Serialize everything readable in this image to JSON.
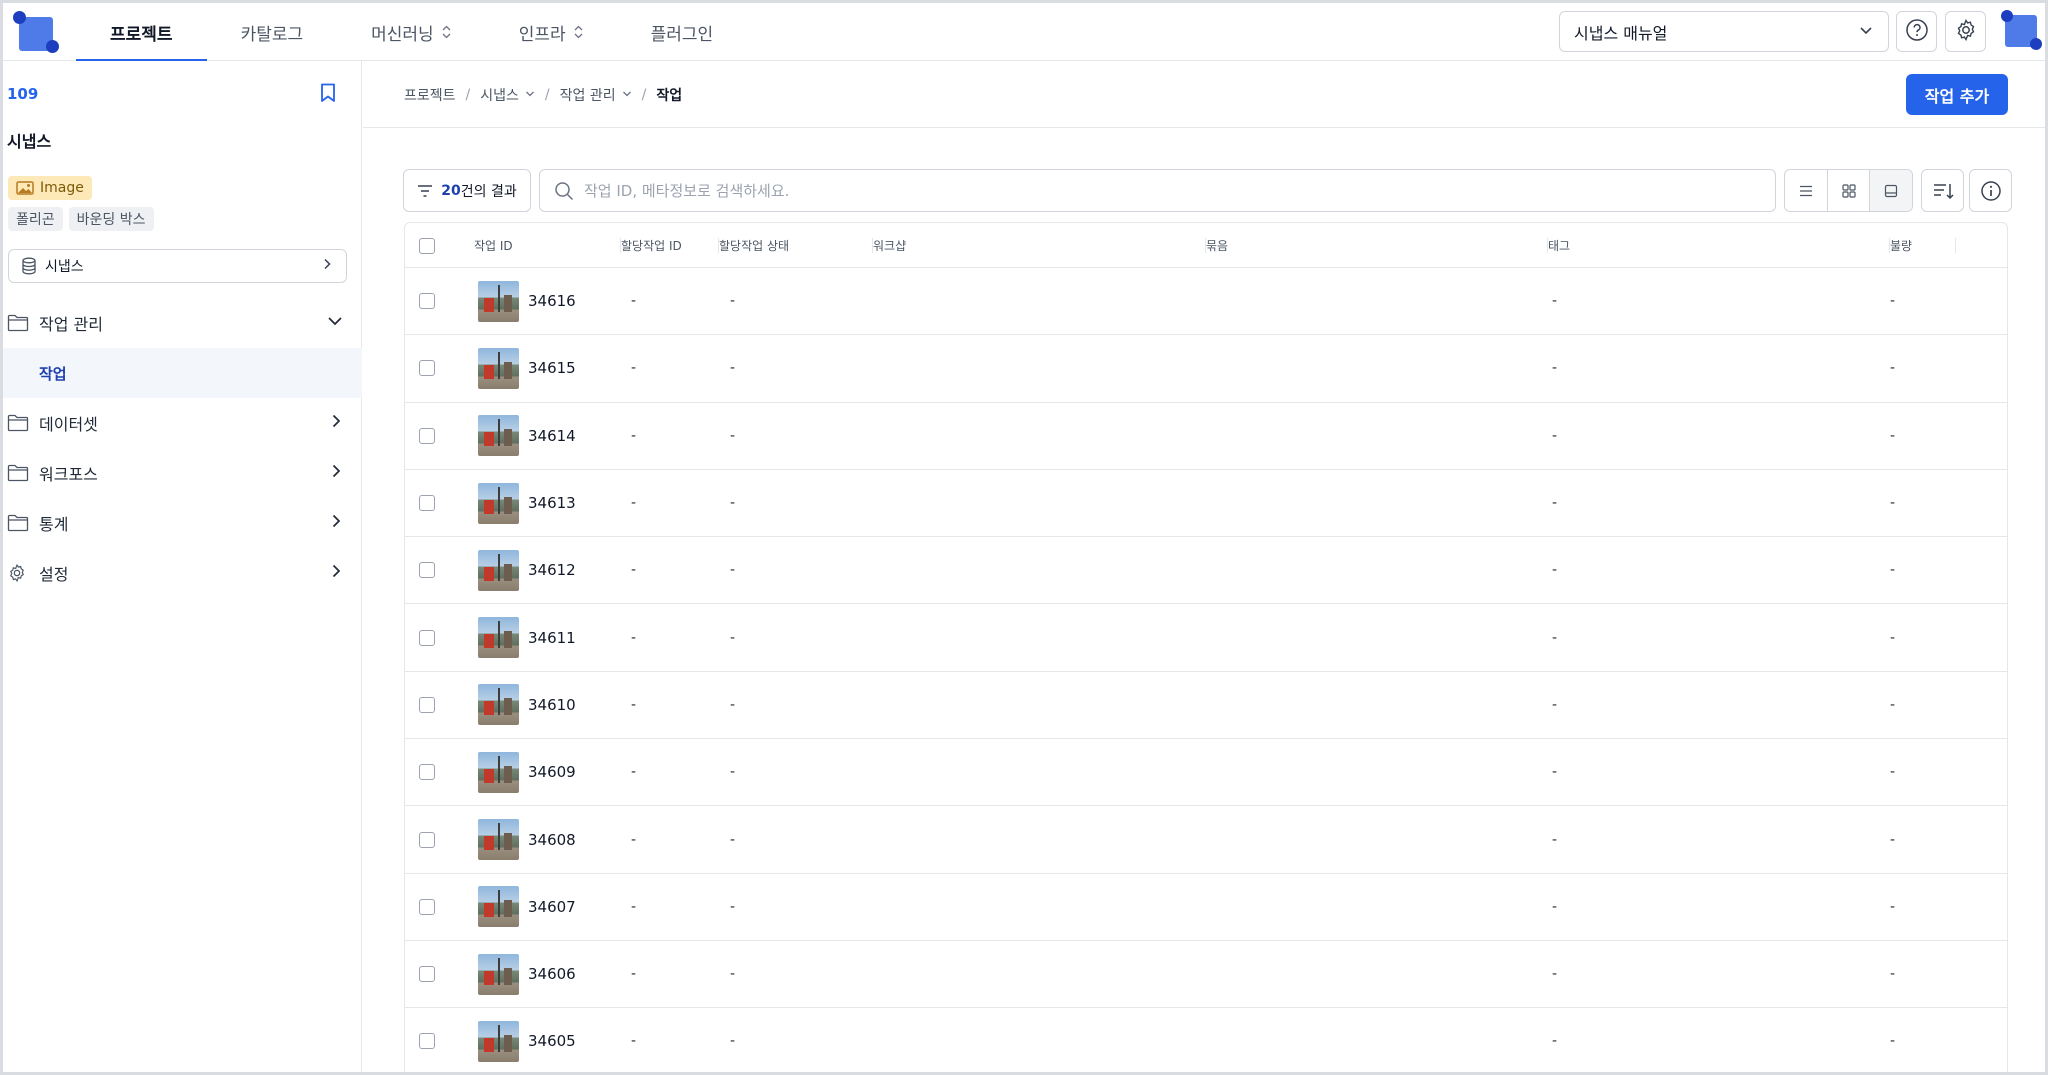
{
  "nav": {
    "tabs": [
      {
        "label": "프로젝트",
        "active": true,
        "has_updown": false
      },
      {
        "label": "카탈로그",
        "active": false,
        "has_updown": false
      },
      {
        "label": "머신러닝",
        "active": false,
        "has_updown": true
      },
      {
        "label": "인프라",
        "active": false,
        "has_updown": true
      },
      {
        "label": "플러그인",
        "active": false,
        "has_updown": false
      }
    ],
    "manual_select": "시냅스 매뉴얼",
    "icons": [
      "help-icon",
      "gear-icon"
    ],
    "accent_color": "#2563eb"
  },
  "sidebar": {
    "project_id": "109",
    "project_name": "시냅스",
    "data_type": "Image",
    "annotation_types": [
      "폴리곤",
      "바운딩 박스"
    ],
    "dataset": "시냅스",
    "menu": [
      {
        "label": "작업 관리",
        "icon": "folder-icon",
        "expanded": true
      },
      {
        "label": "데이터셋",
        "icon": "folder-icon",
        "expanded": false
      },
      {
        "label": "워크포스",
        "icon": "folder-icon",
        "expanded": false
      },
      {
        "label": "통계",
        "icon": "folder-icon",
        "expanded": false
      },
      {
        "label": "설정",
        "icon": "gear-icon",
        "expanded": false
      }
    ],
    "submenu_active": "작업"
  },
  "breadcrumb": [
    {
      "label": "프로젝트",
      "dropdown": false
    },
    {
      "label": "시냅스",
      "dropdown": true
    },
    {
      "label": "작업 관리",
      "dropdown": true
    },
    {
      "label": "작업",
      "dropdown": false
    }
  ],
  "add_button": "작업 추가",
  "toolbar": {
    "result_count": "20",
    "result_suffix": "건의 결과",
    "search_placeholder": "작업 ID, 메타정보로 검색하세요."
  },
  "table": {
    "columns": [
      "작업 ID",
      "할당작업 ID",
      "할당작업 상태",
      "워크샵",
      "묶음",
      "태그",
      "불량"
    ],
    "rows": [
      {
        "id": "34616",
        "assign_id": "-",
        "assign_status": "-",
        "tag": "-",
        "defect": "-"
      },
      {
        "id": "34615",
        "assign_id": "-",
        "assign_status": "-",
        "tag": "-",
        "defect": "-"
      },
      {
        "id": "34614",
        "assign_id": "-",
        "assign_status": "-",
        "tag": "-",
        "defect": "-"
      },
      {
        "id": "34613",
        "assign_id": "-",
        "assign_status": "-",
        "tag": "-",
        "defect": "-"
      },
      {
        "id": "34612",
        "assign_id": "-",
        "assign_status": "-",
        "tag": "-",
        "defect": "-"
      },
      {
        "id": "34611",
        "assign_id": "-",
        "assign_status": "-",
        "tag": "-",
        "defect": "-"
      },
      {
        "id": "34610",
        "assign_id": "-",
        "assign_status": "-",
        "tag": "-",
        "defect": "-"
      },
      {
        "id": "34609",
        "assign_id": "-",
        "assign_status": "-",
        "tag": "-",
        "defect": "-"
      },
      {
        "id": "34608",
        "assign_id": "-",
        "assign_status": "-",
        "tag": "-",
        "defect": "-"
      },
      {
        "id": "34607",
        "assign_id": "-",
        "assign_status": "-",
        "tag": "-",
        "defect": "-"
      },
      {
        "id": "34606",
        "assign_id": "-",
        "assign_status": "-",
        "tag": "-",
        "defect": "-"
      },
      {
        "id": "34605",
        "assign_id": "-",
        "assign_status": "-",
        "tag": "-",
        "defect": "-"
      }
    ]
  }
}
